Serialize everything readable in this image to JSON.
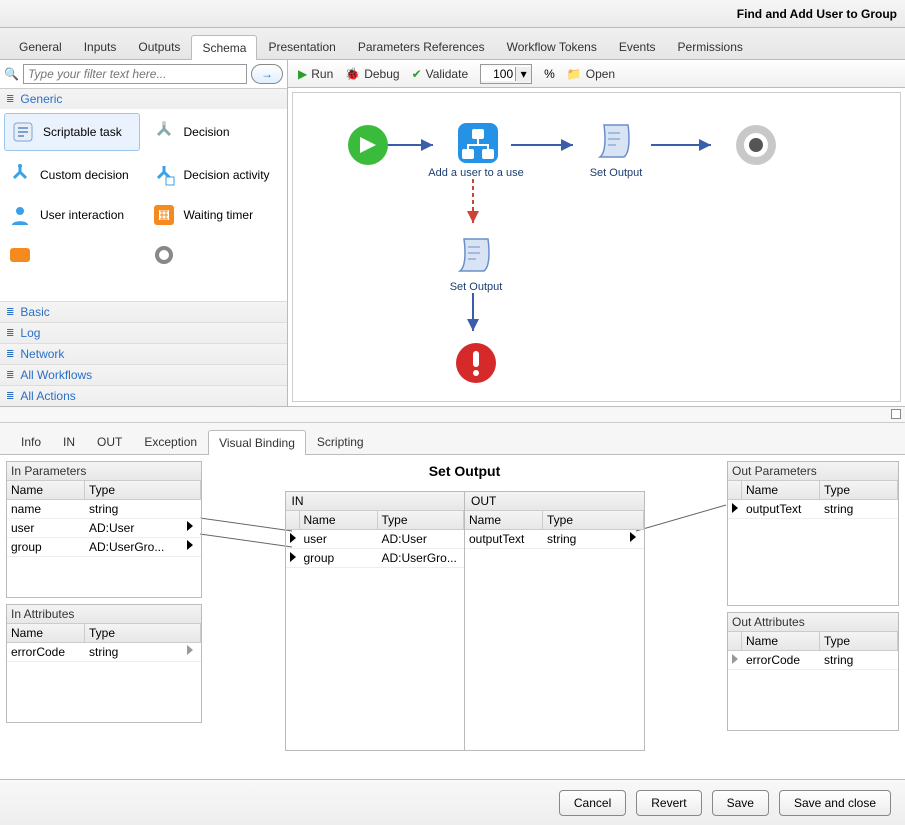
{
  "title": "Find and Add User to Group",
  "top_tabs": [
    "General",
    "Inputs",
    "Outputs",
    "Schema",
    "Presentation",
    "Parameters References",
    "Workflow Tokens",
    "Events",
    "Permissions"
  ],
  "active_top_tab": "Schema",
  "search": {
    "placeholder": "Type your filter text here..."
  },
  "palette_sections": {
    "open": "Generic",
    "others": [
      "Basic",
      "Log",
      "Network",
      "All Workflows",
      "All Actions"
    ]
  },
  "palette_items": [
    {
      "label": "Scriptable task",
      "icon": "script-icon",
      "selected": true
    },
    {
      "label": "Decision",
      "icon": "decision-icon"
    },
    {
      "label": "Custom decision",
      "icon": "custom-decision-icon"
    },
    {
      "label": "Decision activity",
      "icon": "decision-activity-icon"
    },
    {
      "label": "User interaction",
      "icon": "user-icon"
    },
    {
      "label": "Waiting timer",
      "icon": "timer-icon"
    }
  ],
  "toolbar": {
    "run": "Run",
    "debug": "Debug",
    "validate": "Validate",
    "zoom": "100",
    "pct": "%",
    "open": "Open"
  },
  "canvas": {
    "nodes": {
      "start": "",
      "addUser": "Add a user to a use",
      "setOutput1": "Set Output",
      "end": "",
      "setOutput2": "Set Output",
      "error": ""
    }
  },
  "inner_tabs": [
    "Info",
    "IN",
    "OUT",
    "Exception",
    "Visual Binding",
    "Scripting"
  ],
  "active_inner_tab": "Visual Binding",
  "vb": {
    "title": "Set Output",
    "inParams": {
      "header": "In Parameters",
      "cols": [
        "Name",
        "Type"
      ],
      "rows": [
        [
          "name",
          "string"
        ],
        [
          "user",
          "AD:User"
        ],
        [
          "group",
          "AD:UserGro..."
        ]
      ]
    },
    "inAttrs": {
      "header": "In Attributes",
      "cols": [
        "Name",
        "Type"
      ],
      "rows": [
        [
          "errorCode",
          "string"
        ]
      ]
    },
    "midIn": {
      "header": "IN",
      "cols": [
        "Name",
        "Type"
      ],
      "rows": [
        [
          "user",
          "AD:User"
        ],
        [
          "group",
          "AD:UserGro..."
        ]
      ]
    },
    "midOut": {
      "header": "OUT",
      "cols": [
        "Name",
        "Type"
      ],
      "rows": [
        [
          "outputText",
          "string"
        ]
      ]
    },
    "outParams": {
      "header": "Out Parameters",
      "cols": [
        "Name",
        "Type"
      ],
      "rows": [
        [
          "outputText",
          "string"
        ]
      ]
    },
    "outAttrs": {
      "header": "Out Attributes",
      "cols": [
        "Name",
        "Type"
      ],
      "rows": [
        [
          "errorCode",
          "string"
        ]
      ]
    }
  },
  "footer": {
    "cancel": "Cancel",
    "revert": "Revert",
    "save": "Save",
    "saveclose": "Save and close"
  }
}
